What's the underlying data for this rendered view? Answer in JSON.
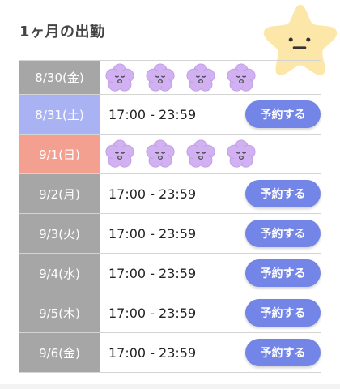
{
  "header": {
    "title": "1ヶ月の出勤"
  },
  "colors": {
    "weekday_date_bg": "#a6a6a6",
    "saturday_date_bg": "#a9b3f3",
    "sunday_date_bg": "#f3a090",
    "reserve_button_bg": "#7385e6",
    "flower_fill": "#d1b1f1",
    "mascot_star_fill": "#fce7a8"
  },
  "icons": {
    "mascot": "smiling-star-mascot",
    "off_day": "flower-face-icon"
  },
  "schedule": {
    "rows": [
      {
        "date": "8/30(金)",
        "type": "weekday",
        "status": "off",
        "time": "",
        "button": ""
      },
      {
        "date": "8/31(土)",
        "type": "saturday",
        "status": "available",
        "time": "17:00 - 23:59",
        "button": "予約する"
      },
      {
        "date": "9/1(日)",
        "type": "sunday",
        "status": "off",
        "time": "",
        "button": ""
      },
      {
        "date": "9/2(月)",
        "type": "weekday",
        "status": "available",
        "time": "17:00 - 23:59",
        "button": "予約する"
      },
      {
        "date": "9/3(火)",
        "type": "weekday",
        "status": "available",
        "time": "17:00 - 23:59",
        "button": "予約する"
      },
      {
        "date": "9/4(水)",
        "type": "weekday",
        "status": "available",
        "time": "17:00 - 23:59",
        "button": "予約する"
      },
      {
        "date": "9/5(木)",
        "type": "weekday",
        "status": "available",
        "time": "17:00 - 23:59",
        "button": "予約する"
      },
      {
        "date": "9/6(金)",
        "type": "weekday",
        "status": "available",
        "time": "17:00 - 23:59",
        "button": "予約する"
      }
    ]
  }
}
